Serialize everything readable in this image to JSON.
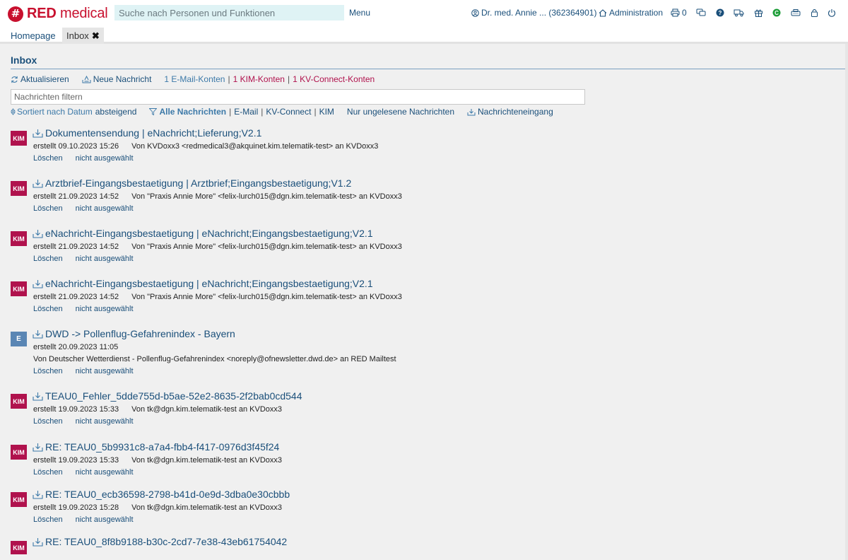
{
  "brand": {
    "name_bold": "RED",
    "name_rest": " medical",
    "color": "#c8102e"
  },
  "header": {
    "search_placeholder": "Suche nach Personen und Funktionen",
    "menu_label": "Menu",
    "user_label": "Dr. med. Annie ... (362364901)",
    "admin_label": "Administration",
    "print_count": "0"
  },
  "tabs": [
    {
      "label": "Homepage"
    },
    {
      "label": "Inbox"
    }
  ],
  "inbox": {
    "title": "Inbox",
    "refresh_label": "Aktualisieren",
    "new_message_label": "Neue Nachricht",
    "accounts": {
      "email": "1 E-Mail-Konten",
      "kim": "1 KIM-Konten",
      "kv": "1 KV-Connect-Konten"
    },
    "filter_placeholder": "Nachrichten filtern",
    "sort_prefix": "Sortiert nach Datum",
    "sort_order": "absteigend",
    "filter_all": "Alle Nachrichten",
    "filter_email": "E-Mail",
    "filter_kv": "KV-Connect",
    "filter_kim": "KIM",
    "unread_label": "Nur ungelesene Nachrichten",
    "incoming_label": "Nachrichteneingang"
  },
  "messages": [
    {
      "badge": "KIM",
      "title": "Dokumentensendung | eNachricht;Lieferung;V2.1",
      "created": "erstellt 09.10.2023 15:26",
      "from": "Von KVDoxx3 <redmedical3@akquinet.kim.telematik-test> an KVDoxx3",
      "delete": "Löschen",
      "selected": "nicht ausgewählt"
    },
    {
      "badge": "KIM",
      "title": "Arztbrief-Eingangsbestaetigung | Arztbrief;Eingangsbestaetigung;V1.2",
      "created": "erstellt 21.09.2023 14:52",
      "from": "Von \"Praxis Annie More\" <felix-lurch015@dgn.kim.telematik-test> an KVDoxx3",
      "delete": "Löschen",
      "selected": "nicht ausgewählt"
    },
    {
      "badge": "KIM",
      "title": "eNachricht-Eingangsbestaetigung | eNachricht;Eingangsbestaetigung;V2.1",
      "created": "erstellt 21.09.2023 14:52",
      "from": "Von \"Praxis Annie More\" <felix-lurch015@dgn.kim.telematik-test> an KVDoxx3",
      "delete": "Löschen",
      "selected": "nicht ausgewählt"
    },
    {
      "badge": "KIM",
      "title": "eNachricht-Eingangsbestaetigung | eNachricht;Eingangsbestaetigung;V2.1",
      "created": "erstellt 21.09.2023 14:52",
      "from": "Von \"Praxis Annie More\" <felix-lurch015@dgn.kim.telematik-test> an KVDoxx3",
      "delete": "Löschen",
      "selected": "nicht ausgewählt"
    },
    {
      "badge": "E",
      "title": "DWD -> Pollenflug-Gefahrenindex - Bayern",
      "created": "erstellt 20.09.2023 11:05",
      "from": "Von Deutscher Wetterdienst - Pollenflug-Gefahrenindex <noreply@ofnewsletter.dwd.de> an RED Mailtest",
      "delete": "Löschen",
      "selected": "nicht ausgewählt"
    },
    {
      "badge": "KIM",
      "title": "TEAU0_Fehler_5dde755d-b5ae-52e2-8635-2f2bab0cd544",
      "created": "erstellt 19.09.2023 15:33",
      "from": "Von tk@dgn.kim.telematik-test an KVDoxx3",
      "delete": "Löschen",
      "selected": "nicht ausgewählt"
    },
    {
      "badge": "KIM",
      "title": "RE: TEAU0_5b9931c8-a7a4-fbb4-f417-0976d3f45f24",
      "created": "erstellt 19.09.2023 15:33",
      "from": "Von tk@dgn.kim.telematik-test an KVDoxx3",
      "delete": "Löschen",
      "selected": "nicht ausgewählt"
    },
    {
      "badge": "KIM",
      "title": "RE: TEAU0_ecb36598-2798-b41d-0e9d-3dba0e30cbbb",
      "created": "erstellt 19.09.2023 15:28",
      "from": "Von tk@dgn.kim.telematik-test an KVDoxx3",
      "delete": "Löschen",
      "selected": "nicht ausgewählt"
    },
    {
      "badge": "KIM",
      "title": "RE: TEAU0_8f8b9188-b30c-2cd7-7e38-43eb61754042"
    }
  ]
}
